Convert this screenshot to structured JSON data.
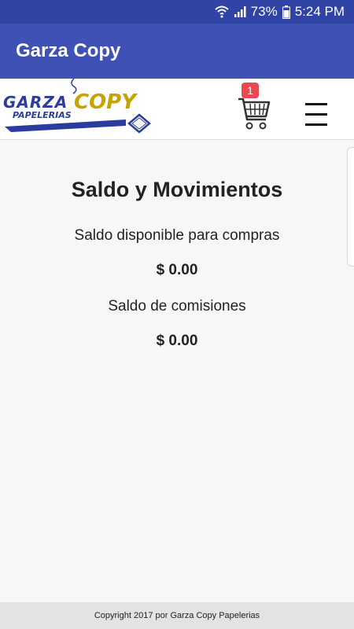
{
  "status_bar": {
    "battery": "73%",
    "time": "5:24 PM",
    "icons": [
      "wifi-icon",
      "signal-icon",
      "battery-icon"
    ]
  },
  "app_bar": {
    "title": "Garza Copy",
    "color": "#3f51b5"
  },
  "header": {
    "logo": {
      "word1": "GARZA",
      "word2": "COPY",
      "word3": "PAPELERIAS"
    },
    "cart_count": "1",
    "icons": [
      "cart-icon",
      "hamburger-menu-icon"
    ]
  },
  "main": {
    "title": "Saldo y Movimientos",
    "available_label": "Saldo disponible para compras",
    "available_amount": "$ 0.00",
    "commissions_label": "Saldo de comisiones",
    "commissions_amount": "$ 0.00"
  },
  "footer": {
    "text": "Copyright 2017 por Garza Copy Papelerias"
  }
}
